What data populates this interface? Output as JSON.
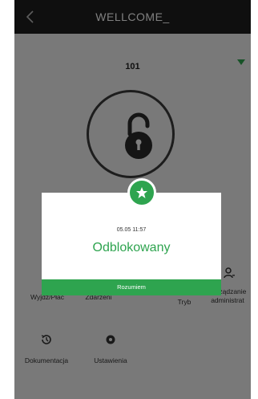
{
  "header": {
    "title": "WELLCOME_"
  },
  "door": {
    "name": "101"
  },
  "grid": {
    "items": [
      {
        "label": "Wyjdź/Płać",
        "icon": "calendar-icon"
      },
      {
        "label": "Zdarzeni",
        "icon": "event-icon"
      },
      {
        "label": "Tryb",
        "icon": "mode-icon"
      },
      {
        "label": "Zarządzanie administrat",
        "icon": "admin-user-icon"
      },
      {
        "label": "Dokumentacja",
        "icon": "history-icon"
      },
      {
        "label": "Ustawienia",
        "icon": "settings-icon"
      }
    ]
  },
  "modal": {
    "time": "05.05 11:57",
    "status": "Odblokowany",
    "button_label": "Rozumiem",
    "badge_icon": "star-icon"
  },
  "colors": {
    "accent": "#2ea44f",
    "header": "#1e1e1e",
    "overlay": "rgba(0,0,0,0.5)"
  }
}
